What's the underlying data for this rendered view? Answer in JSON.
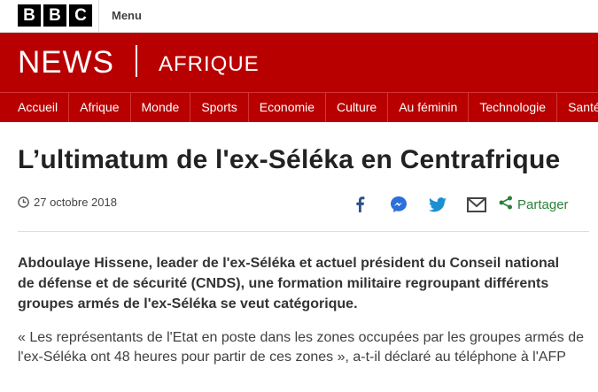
{
  "brand": {
    "letters": [
      "B",
      "B",
      "C"
    ],
    "menu_label": "Menu"
  },
  "header": {
    "news": "NEWS",
    "section": "AFRIQUE",
    "color": "#b80000"
  },
  "nav": {
    "items": [
      "Accueil",
      "Afrique",
      "Monde",
      "Sports",
      "Economie",
      "Culture",
      "Au féminin",
      "Technologie",
      "Santé"
    ]
  },
  "article": {
    "title": "L’ultimatum de l'ex-Séléka en Centrafrique",
    "date": "27 octobre 2018",
    "lead": "Abdoulaye Hissene, leader de l'ex-Séléka et actuel président du Conseil national de défense et de sécurité (CNDS), une formation militaire regroupant différents groupes armés de l'ex-Séléka se veut catégorique.",
    "body": "« Les représentants de l'Etat en poste dans les zones occupées par les groupes armés de l'ex-Séléka ont 48 heures pour partir de ces zones », a-t-il déclaré au téléphone à l'AFP"
  },
  "share": {
    "icons": [
      "facebook-icon",
      "messenger-icon",
      "twitter-icon",
      "email-icon"
    ],
    "label": "Partager",
    "accent": "#29813a",
    "icon_color": "#2b4f8a"
  }
}
